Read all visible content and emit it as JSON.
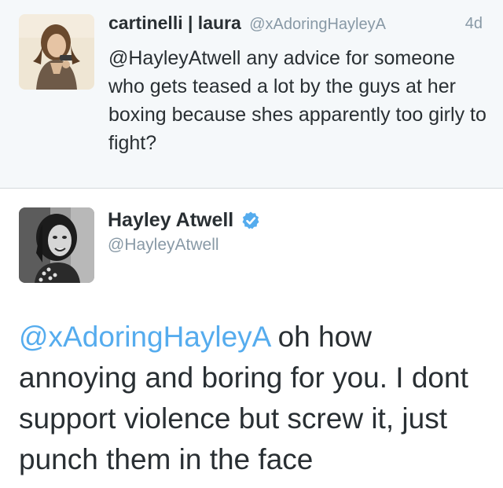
{
  "reply_tweet": {
    "name": "cartinelli | laura",
    "handle": "@xAdoringHayleyA",
    "time": "4d",
    "text": "@HayleyAtwell any advice for someone who gets teased a lot by the guys at her boxing because shes apparently too girly to fight?"
  },
  "main_tweet": {
    "name": "Hayley Atwell",
    "verified_icon": "verified-badge-icon",
    "handle": "@HayleyAtwell",
    "mention": "@xAdoringHayleyA",
    "text": " oh how annoying and boring for you. I dont support violence but screw it, just punch them in the face"
  },
  "colors": {
    "link_blue": "#55acee",
    "muted_gray": "#8899a6",
    "text_dark": "#292f33",
    "reply_bg": "#f5f8fa"
  }
}
